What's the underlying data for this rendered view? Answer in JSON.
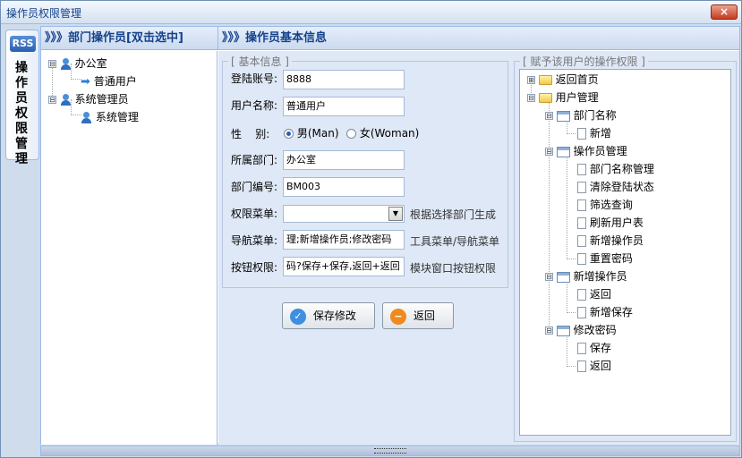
{
  "window": {
    "title": "操作员权限管理",
    "close_glyph": "×"
  },
  "sidebar_tab": {
    "badge": "RSS",
    "label": "操作员权限管理"
  },
  "headers": {
    "left": "》》》部门操作员[双击选中]",
    "right": "》》》操作员基本信息"
  },
  "dept_tree": [
    {
      "label": "办公室",
      "expander": "⊟",
      "children": [
        {
          "label": "普通用户"
        }
      ]
    },
    {
      "label": "系统管理员",
      "expander": "⊟",
      "children": [
        {
          "label": "系统管理"
        }
      ]
    }
  ],
  "form": {
    "legend": "[ 基本信息 ]",
    "login_label": "登陆账号:",
    "login_value": "8888",
    "username_label": "用户名称:",
    "username_value": "普通用户",
    "gender_label": "性    别:",
    "gender_male": "男(Man)",
    "gender_female": "女(Woman)",
    "gender_selected": "male",
    "dept_label": "所属部门:",
    "dept_value": "办公室",
    "deptno_label": "部门编号:",
    "deptno_value": "BM003",
    "perm_menu_label": "权限菜单:",
    "perm_menu_value": "",
    "perm_menu_hint": "根据选择部门生成",
    "nav_menu_label": "导航菜单:",
    "nav_menu_value": "理;新增操作员;修改密码",
    "nav_menu_hint": "工具菜单/导航菜单",
    "btn_perm_label": "按钮权限:",
    "btn_perm_value": "码?保存+保存,返回+返回",
    "btn_perm_hint": "模块窗口按钮权限",
    "save_button": "保存修改",
    "back_button": "返回"
  },
  "perm_tree": {
    "legend": "[ 赋予该用户的操作权限 ]",
    "nodes": [
      {
        "label": "返回首页",
        "level": 0,
        "icon": "folder",
        "expander": "⊞"
      },
      {
        "label": "用户管理",
        "level": 0,
        "icon": "folder-open",
        "expander": "⊟"
      },
      {
        "label": "部门名称",
        "level": 1,
        "icon": "table",
        "expander": "⊟"
      },
      {
        "label": "新增",
        "level": 2,
        "icon": "doc"
      },
      {
        "label": "操作员管理",
        "level": 1,
        "icon": "table",
        "expander": "⊟"
      },
      {
        "label": "部门名称管理",
        "level": 2,
        "icon": "doc"
      },
      {
        "label": "清除登陆状态",
        "level": 2,
        "icon": "doc"
      },
      {
        "label": "筛选查询",
        "level": 2,
        "icon": "doc"
      },
      {
        "label": "刷新用户表",
        "level": 2,
        "icon": "doc"
      },
      {
        "label": "新增操作员",
        "level": 2,
        "icon": "doc"
      },
      {
        "label": "重置密码",
        "level": 2,
        "icon": "doc"
      },
      {
        "label": "新增操作员",
        "level": 1,
        "icon": "table",
        "expander": "⊟"
      },
      {
        "label": "返回",
        "level": 2,
        "icon": "doc"
      },
      {
        "label": "新增保存",
        "level": 2,
        "icon": "doc"
      },
      {
        "label": "修改密码",
        "level": 1,
        "icon": "table",
        "expander": "⊟"
      },
      {
        "label": "保存",
        "level": 2,
        "icon": "doc"
      },
      {
        "label": "返回",
        "level": 2,
        "icon": "doc"
      }
    ]
  },
  "colors": {
    "accent": "#15428b",
    "border": "#99bbe8",
    "panel": "#dfe8f6"
  }
}
